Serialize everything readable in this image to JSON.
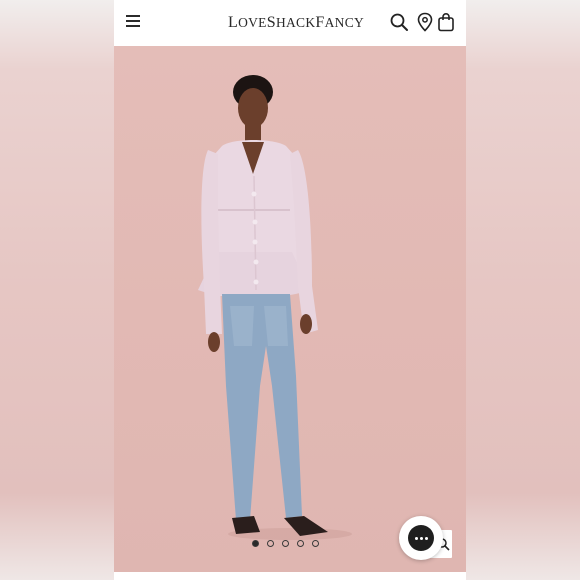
{
  "header": {
    "logo_prefix_L": "L",
    "logo_part1": "OVE",
    "logo_S": "S",
    "logo_part2": "HACK",
    "logo_F": "F",
    "logo_part3": "ANCY"
  },
  "icons": {
    "menu": "hamburger-menu-icon",
    "search": "search-icon",
    "location": "location-pin-icon",
    "bag": "shopping-bag-icon",
    "chat": "chat-icon",
    "zoom": "zoom-icon"
  },
  "carousel": {
    "total_slides": 5,
    "active_index": 0
  },
  "colors": {
    "hero_background": "#e2b9b4",
    "cardigan": "#e8d6e0",
    "jeans": "#8ea8c4",
    "chat_button": "#1f1f1f"
  }
}
